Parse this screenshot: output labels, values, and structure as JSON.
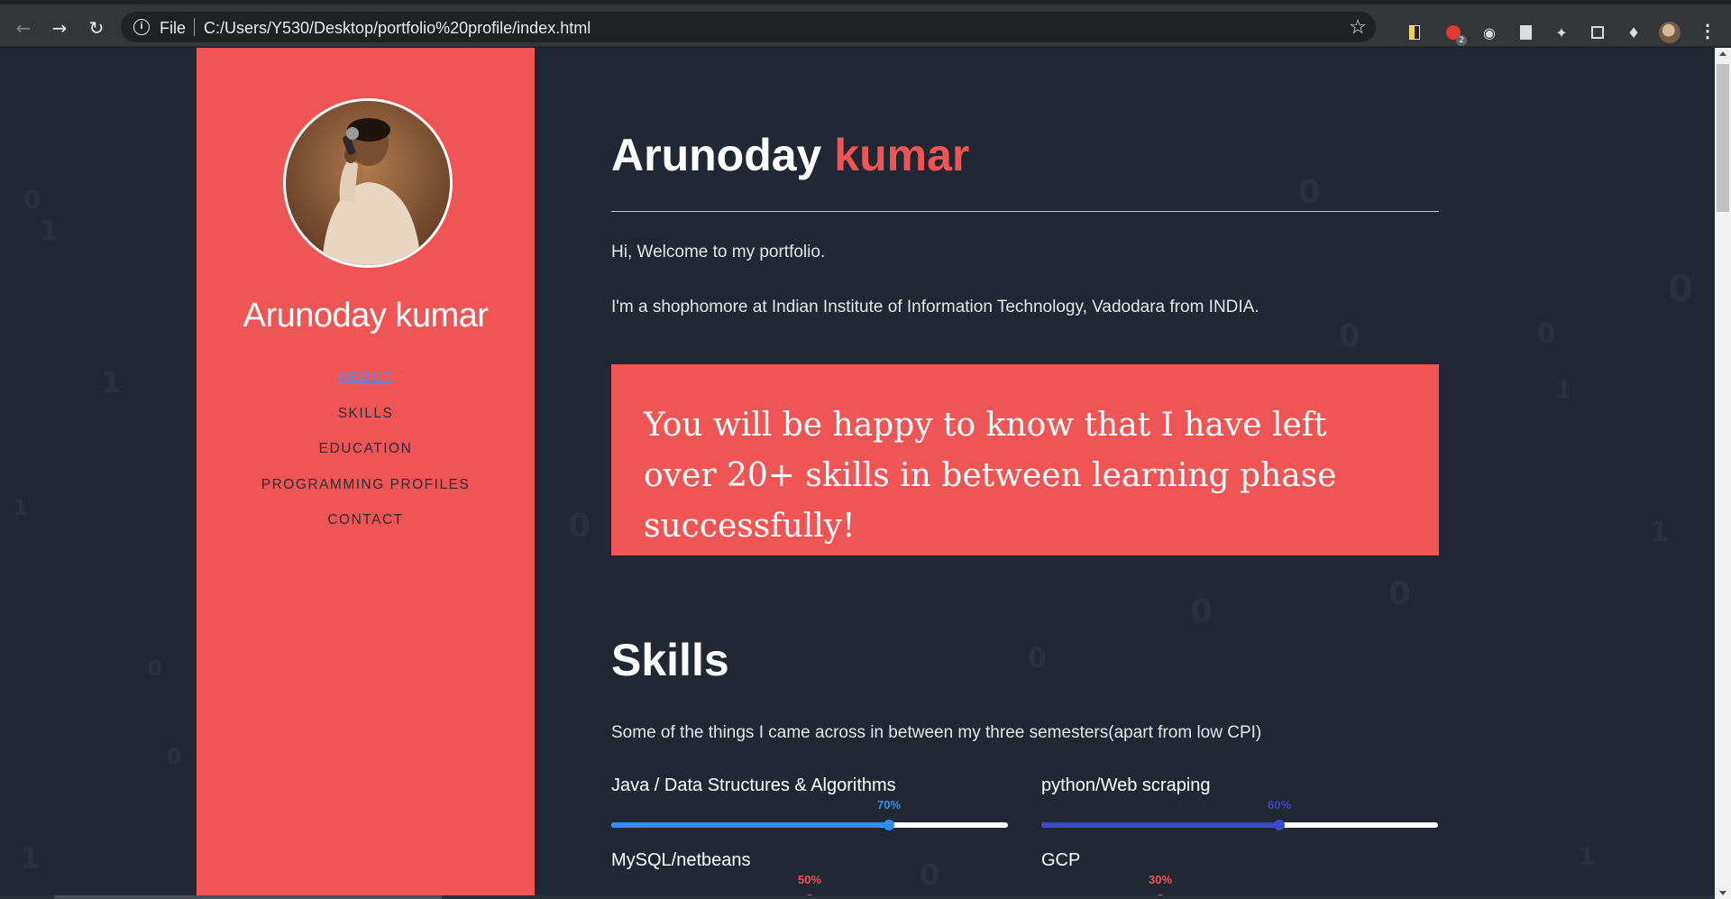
{
  "browser": {
    "scheme": "File",
    "url": "C:/Users/Y530/Desktop/portfolio%20profile/index.html",
    "extension_badge": "2",
    "icons": [
      "back-icon",
      "forward-icon",
      "reload-icon",
      "info-icon",
      "star-icon",
      "extensions-icon",
      "menu-icon"
    ]
  },
  "sidebar": {
    "name": "Arunoday kumar",
    "nav": [
      {
        "label": "ABOUT",
        "active": true
      },
      {
        "label": "SKILLS",
        "active": false
      },
      {
        "label": "EDUCATION",
        "active": false
      },
      {
        "label": "PROGRAMMING PROFILES",
        "active": false
      },
      {
        "label": "CONTACT",
        "active": false
      }
    ]
  },
  "about": {
    "first_name": "Arunoday",
    "last_name": "kumar",
    "greeting": "Hi, Welcome to my portfolio.",
    "intro": "I'm a shophomore at Indian Institute of Information Technology, Vadodara from INDIA.",
    "quote": "You will be happy to know that I have left over 20+ skills in between learning phase successfully!"
  },
  "skills": {
    "heading": "Skills",
    "description": "Some of the things I came across in between my three semesters(apart from low CPI)",
    "items": [
      {
        "label": "Java / Data Structures & Algorithms",
        "percent_label": "70%",
        "level": 0.7,
        "color": "#2f8ff0"
      },
      {
        "label": "python/Web scraping",
        "percent_label": "60%",
        "level": 0.6,
        "color": "#3b49c4"
      },
      {
        "label": "MySQL/netbeans",
        "percent_label": "50%",
        "level": 0.5,
        "color": "#f05555"
      },
      {
        "label": "GCP",
        "percent_label": "30%",
        "level": 0.3,
        "color": "#f05555"
      }
    ]
  },
  "colors": {
    "accent": "#f05555",
    "page_bg": "#212733",
    "link_active": "#4a90f2"
  }
}
